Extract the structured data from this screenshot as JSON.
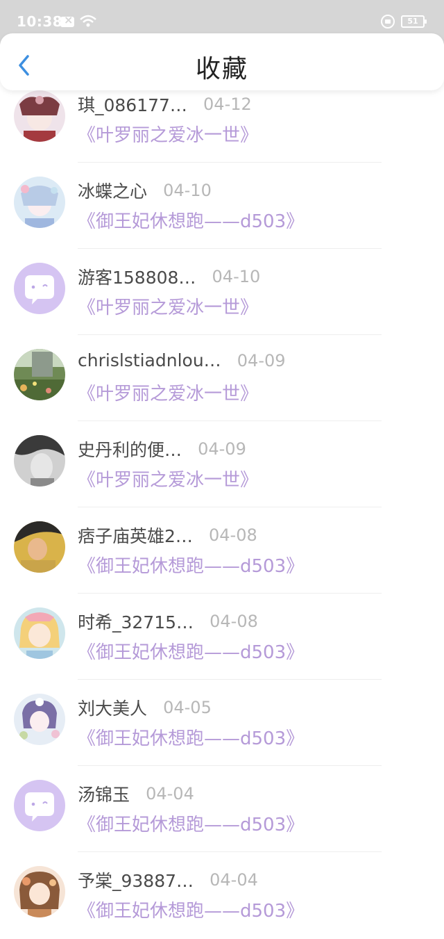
{
  "status_bar": {
    "time": "10:38",
    "battery": "51"
  },
  "header": {
    "title": "收藏"
  },
  "items": [
    {
      "name": "琪_086177…",
      "date": "04-12",
      "book": "《叶罗丽之爱冰一世》",
      "avatar": "anime-red-bow-avatar"
    },
    {
      "name": "冰蝶之心",
      "date": "04-10",
      "book": "《御王妃休想跑——d503》",
      "avatar": "anime-blue-avatar"
    },
    {
      "name": "游客158808…",
      "date": "04-10",
      "book": "《叶罗丽之爱冰一世》",
      "avatar": "default-chat-avatar"
    },
    {
      "name": "chrislstiadnlou…",
      "date": "04-09",
      "book": "《叶罗丽之爱冰一世》",
      "avatar": "garden-photo-avatar"
    },
    {
      "name": "史丹利的便…",
      "date": "04-09",
      "book": "《叶罗丽之爱冰一世》",
      "avatar": "bw-portrait-avatar"
    },
    {
      "name": "痞子庙英雄2…",
      "date": "04-08",
      "book": "《御王妃休想跑——d503》",
      "avatar": "yellow-portrait-avatar"
    },
    {
      "name": "时希_32715…",
      "date": "04-08",
      "book": "《御王妃休想跑——d503》",
      "avatar": "anime-blonde-avatar"
    },
    {
      "name": "刘大美人",
      "date": "04-05",
      "book": "《御王妃休想跑——d503》",
      "avatar": "anime-purple-avatar"
    },
    {
      "name": "汤锦玉",
      "date": "04-04",
      "book": "《御王妃休想跑——d503》",
      "avatar": "default-chat-avatar"
    },
    {
      "name": "予棠_93887…",
      "date": "04-04",
      "book": "《御王妃休想跑——d503》",
      "avatar": "anime-brown-avatar"
    }
  ],
  "colors": {
    "accent": "#3d8fe0",
    "book_title": "#b59ad8",
    "default_avatar_bg": "#d5c4f2"
  }
}
